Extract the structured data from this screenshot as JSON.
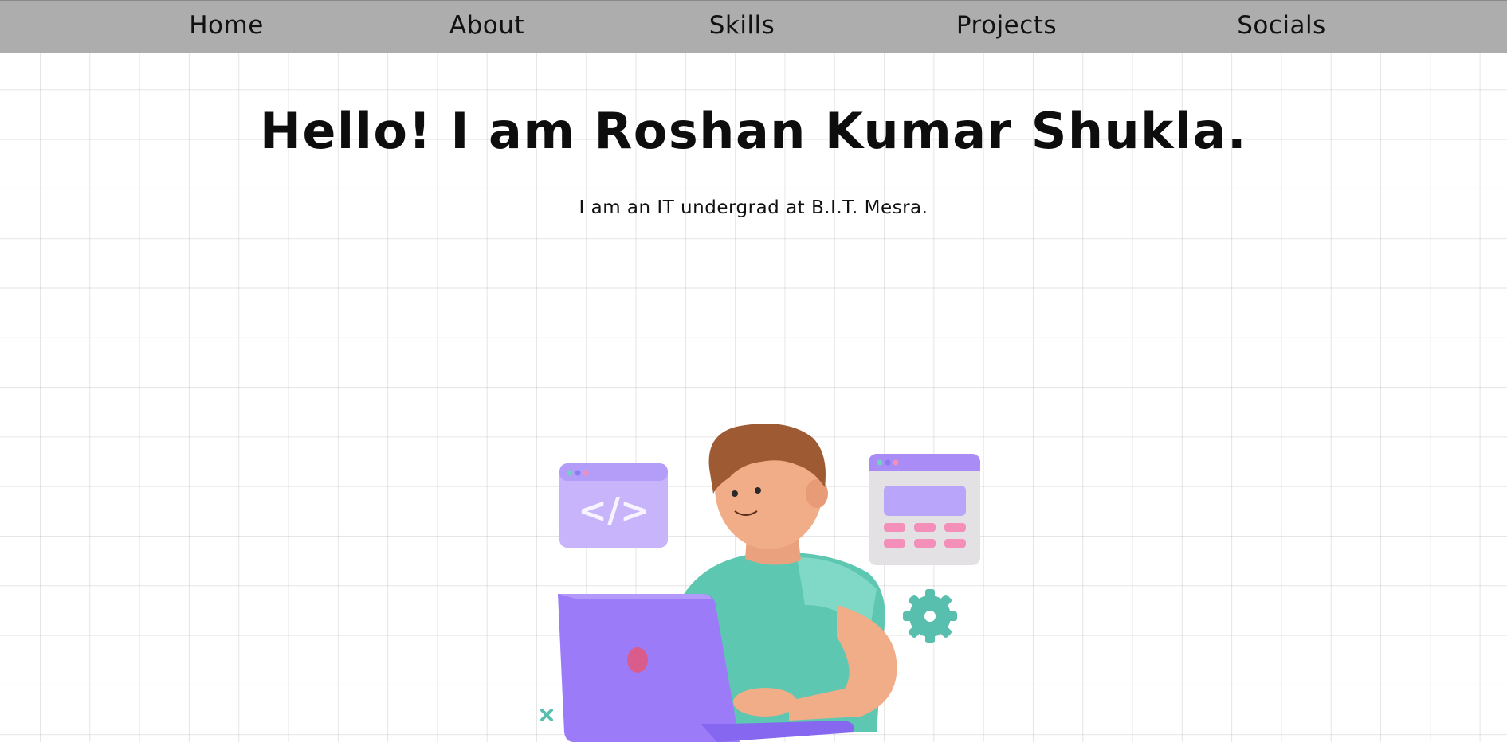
{
  "nav": {
    "home": "Home",
    "about": "About",
    "skills": "Skills",
    "projects": "Projects",
    "socials": "Socials"
  },
  "hero": {
    "title": "Hello! I am Roshan Kumar Shukla.",
    "subtitle": "I am an IT undergrad at B.I.T. Mesra.",
    "code_glyph": "</>"
  },
  "colors": {
    "navbar_bg": "#adadad",
    "accent_purple": "#9b7bf7",
    "shirt_teal": "#5ec7b2",
    "badge_pink": "#f38fb8"
  }
}
